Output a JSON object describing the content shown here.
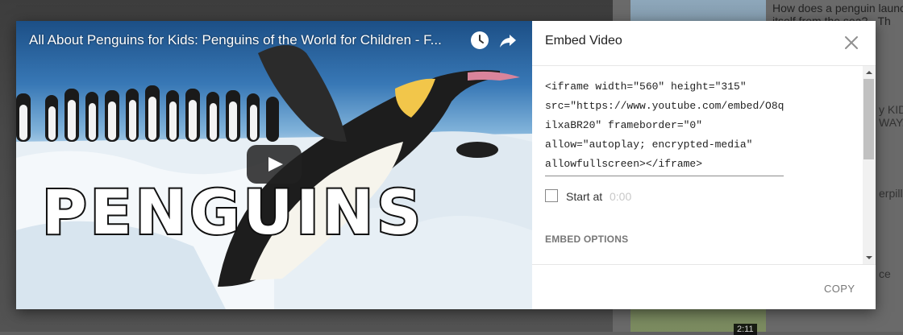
{
  "background": {
    "sidebar_titles": [
      "How does a penguin launc",
      "itself from the sea? - Th",
      "y KIDS",
      "WAY...",
      "erpilla",
      "ce"
    ],
    "duration": "2:11"
  },
  "player": {
    "title": "All About Penguins for Kids: Penguins of the World for Children - F...",
    "overlay_text": "PENGUINS",
    "icons": [
      "watch-later-icon",
      "share-icon",
      "play-icon"
    ]
  },
  "embed": {
    "title": "Embed Video",
    "code": "<iframe width=\"560\" height=\"315\"\nsrc=\"https://www.youtube.com/embed/O8q\nilxaBR20\" frameborder=\"0\"\nallow=\"autoplay; encrypted-media\"\nallowfullscreen></iframe>",
    "start_label": "Start at",
    "start_time": "0:00",
    "options_label": "EMBED OPTIONS",
    "copy_label": "COPY"
  },
  "colors": {
    "accent": "#cc0000",
    "overlay": "#606060"
  }
}
